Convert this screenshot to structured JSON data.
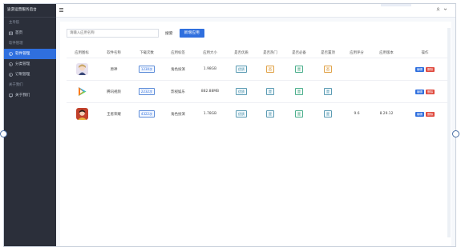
{
  "sidebar": {
    "brand": "途游运营服务后台",
    "groups": [
      {
        "label": "主导航"
      },
      {
        "label": "软件管理"
      },
      {
        "label": "关于我们"
      }
    ],
    "items": [
      {
        "label": "首页",
        "icon": "home-icon"
      },
      {
        "label": "软件管理",
        "icon": "info-icon",
        "active": true
      },
      {
        "label": "分类管理",
        "icon": "info-icon"
      },
      {
        "label": "订制管理",
        "icon": "info-icon"
      },
      {
        "label": "关于我们",
        "icon": "monitor-icon"
      }
    ]
  },
  "header": {
    "menu_icon": "hamburger-icon",
    "user_icon": "user-icon",
    "dropdown_icon": "chevron-down-icon"
  },
  "search": {
    "placeholder": "请输入应用名称",
    "search_label": "搜索",
    "add_label": "新增应用"
  },
  "table": {
    "columns": [
      "应用图标",
      "软件名称",
      "下载次数",
      "应用标签",
      "应用大小",
      "是否优质",
      "是否热门",
      "是否必备",
      "是否置顶",
      "应用评分",
      "应用版本",
      "操作"
    ],
    "rows": [
      {
        "name": "原神",
        "downloads": "1230次",
        "tag": "角色扮演",
        "size": "1.98GB",
        "quality": "优质",
        "hot": "否",
        "must": "是",
        "top": "否",
        "score": "",
        "version": "",
        "icon": "game-avatar-icon"
      },
      {
        "name": "腾讯视频",
        "downloads": "2232次",
        "tag": "影视娱乐",
        "size": "882.88MB",
        "quality": "优质",
        "hot": "是",
        "must": "是",
        "top": "是",
        "score": "",
        "version": "",
        "icon": "video-play-icon"
      },
      {
        "name": "王者荣耀",
        "downloads": "4322次",
        "tag": "角色扮演",
        "size": "1.78GB",
        "quality": "优质",
        "hot": "是",
        "must": "是",
        "top": "是",
        "score": "9.6",
        "version": "8.29.12",
        "icon": "game-hero-icon"
      }
    ],
    "edit_label": "编辑",
    "delete_label": "删除"
  },
  "colors": {
    "accent": "#2f6fde",
    "danger": "#e04a3f",
    "sidebar": "#2b2f3a"
  }
}
